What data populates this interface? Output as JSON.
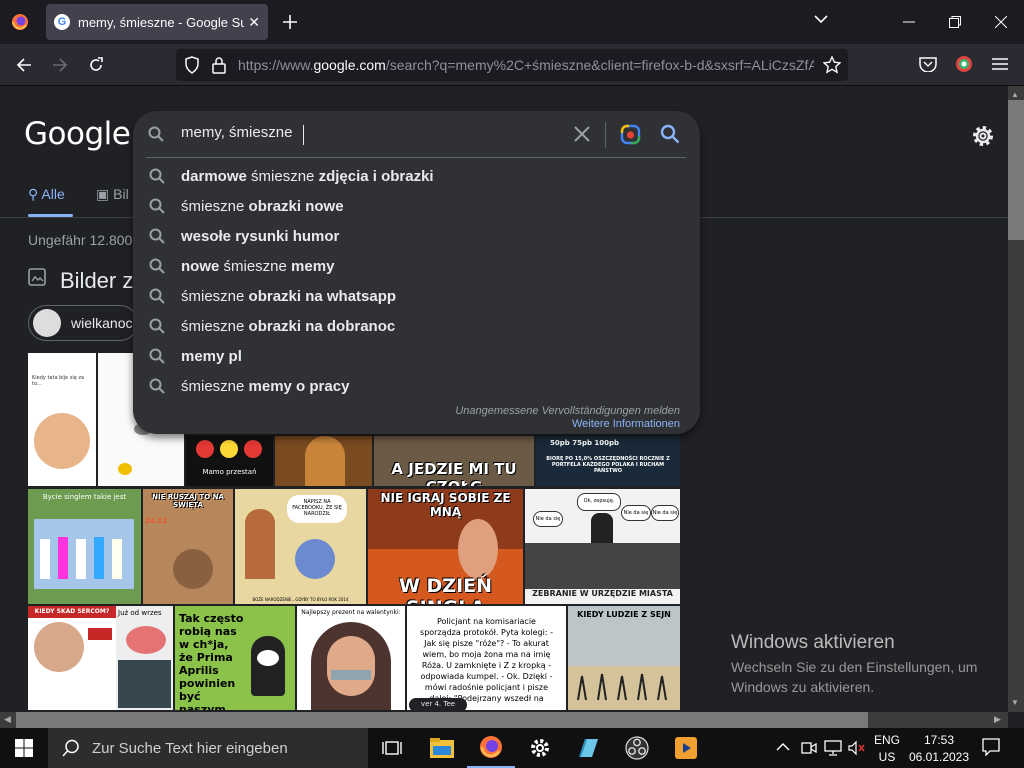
{
  "browser": {
    "tab_title": "memy, śmieszne - Google Suche",
    "tab_favicon": "G",
    "url_prefix": "https://www.",
    "url_domain": "google.com",
    "url_rest": "/search?q=memy%2C+śmieszne&client=firefox-b-d&sxsrf=ALiCzsZfA"
  },
  "google": {
    "logo": "Google",
    "query": "memy, śmieszne",
    "suggestions": [
      {
        "bold_a": "darmowe",
        "normal": " śmieszne ",
        "bold_b": "zdjęcia i obrazki"
      },
      {
        "bold_a": "",
        "normal": "śmieszne ",
        "bold_b": "obrazki nowe"
      },
      {
        "bold_a": "wesołe rysunki humor",
        "normal": "",
        "bold_b": ""
      },
      {
        "bold_a": "nowe",
        "normal": " śmieszne ",
        "bold_b": "memy"
      },
      {
        "bold_a": "",
        "normal": "śmieszne ",
        "bold_b": "obrazki na whatsapp"
      },
      {
        "bold_a": "",
        "normal": "śmieszne ",
        "bold_b": "obrazki na dobranoc"
      },
      {
        "bold_a": "memy pl",
        "normal": "",
        "bold_b": ""
      },
      {
        "bold_a": "",
        "normal": "śmieszne ",
        "bold_b": "memy o pracy"
      }
    ],
    "report_link": "Unangemessene Vervollständigungen melden",
    "more_info_link": "Weitere Informationen",
    "tab_all": "Alle",
    "tab_images": "Bil",
    "stats": "Ungefähr 12.800",
    "images_heading": "Bilder z",
    "chip_label": "wielkanoc",
    "image_captions": {
      "a_jedzie": "A JEDZIE MI TU CZOŁG",
      "singlem": "Bycie singlem takie jest",
      "nie_ruszaj": "NIE RUSZAJ TO NA ŚWIĘTA",
      "nie_igraj": "NIE IGRAJ SOBIE ZE MNĄ",
      "w_dzien": "W DZIEŃ SINGLA",
      "urzad": "ZEBRANIE W URZĘDZIE MIASTA",
      "tak_czesto": "Tak często robią nas w ch*ja, że Prima Aprilis powinien być naszym świętem narodowym...",
      "najlepszy": "Najlepszy prezent na walentynki:",
      "kiedy": "KIEDY LUDZIE Z SEJN",
      "juz_od": "Już od wrzes",
      "bior": "BIORĘ PO 15,0% OSZCZĘDNOŚCI ROCZNIE Z PORTFELA KAŻDEGO POLAKA I RUCHAM PAŃSTWO",
      "mamo": "Mamo przestań",
      "policjant": "Policjant na komisariacie sporządza protokół. Pyta kolegi: - Jak się pisze \"róże\"? - To akurat wiem, bo moja żona ma na imię Róża. U zamknięte i Z z kropką - odpowiada kumpel. - Ok. Dzięki - mówi radośnie policjant i pisze dalej: \"Podejrzany wszedł na"
    },
    "bubble": "Ok, zepsuję.",
    "bubble2": "Nie da się",
    "comic_text": "NAPISZ NA FACEBOOKU, ŻE SIĘ NARODZIŁ",
    "comic_footer": "BOŻE NARODZENIE...GDYBY TO BYŁO ROK 2014",
    "bior_pct": "50pb  75pb  100pb",
    "date_box": "24.12",
    "kiedy_skad": "KIEDY SKAD SERCOM?",
    "policjant_footer": "ver 4. Tee"
  },
  "watermark": {
    "title": "Windows aktivieren",
    "line1": "Wechseln Sie zu den Einstellungen, um",
    "line2": "Windows zu aktivieren."
  },
  "taskbar": {
    "search_placeholder": "Zur Suche Text hier eingeben",
    "lang1": "ENG",
    "lang2": "US",
    "time": "17:53",
    "date": "06.01.2023"
  },
  "colors": {
    "accent_link": "#8ab4f8",
    "page_bg": "#202124",
    "box_bg": "#303134"
  }
}
